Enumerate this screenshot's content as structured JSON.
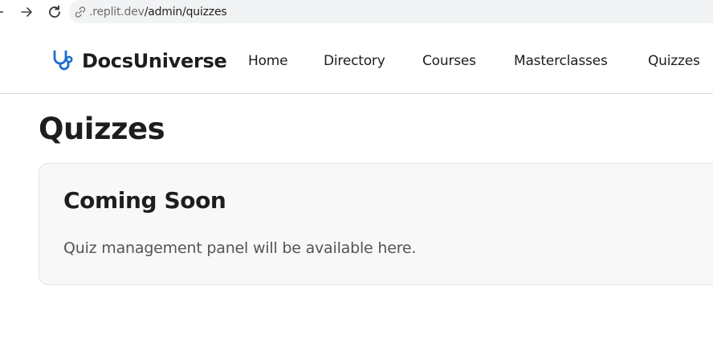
{
  "browser": {
    "url_host": ".replit.dev",
    "url_path": "/admin/quizzes",
    "icons": [
      "arrow-left-icon",
      "arrow-right-icon",
      "reload-icon",
      "link-icon"
    ]
  },
  "header": {
    "brand": "DocsUniverse",
    "brand_icon": "stethoscope-icon",
    "brand_color": "#1a6fd1",
    "nav": {
      "home": "Home",
      "directory": "Directory",
      "courses": "Courses",
      "masterclasses": "Masterclasses",
      "quizzes": "Quizzes"
    }
  },
  "main": {
    "title": "Quizzes",
    "card": {
      "title": "Coming Soon",
      "text": "Quiz management panel will be available here."
    }
  }
}
